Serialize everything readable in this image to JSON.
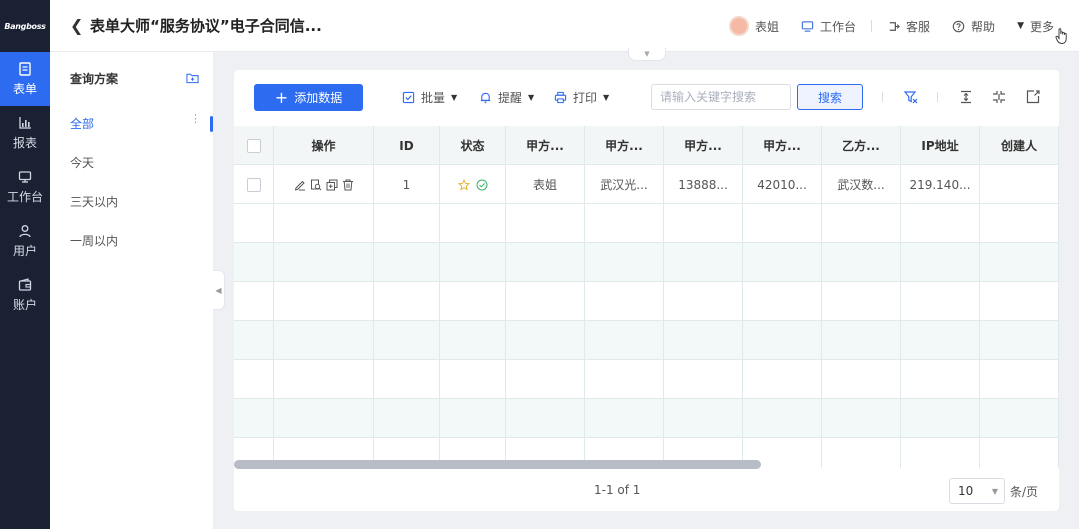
{
  "app": {
    "logo_text": "Bangboss",
    "page_title": "表单大师“服务协议”电子合同信..."
  },
  "rail": [
    {
      "label": "表单",
      "icon": "form-icon",
      "active": true
    },
    {
      "label": "报表",
      "icon": "chart-icon",
      "active": false
    },
    {
      "label": "工作台",
      "icon": "workbench-icon",
      "active": false
    },
    {
      "label": "用户",
      "icon": "user-icon",
      "active": false
    },
    {
      "label": "账户",
      "icon": "wallet-icon",
      "active": false
    }
  ],
  "header": {
    "user_name": "表姐",
    "workbench": "工作台",
    "service": "客服",
    "help": "帮助",
    "more": "更多"
  },
  "plans": {
    "title": "查询方案",
    "items": [
      "全部",
      "今天",
      "三天以内",
      "一周以内"
    ],
    "active_index": 0
  },
  "toolbar": {
    "add_label": "添加数据",
    "batch_label": "批量",
    "remind_label": "提醒",
    "print_label": "打印",
    "search_placeholder": "请输入关键字搜索",
    "search_button": "搜索"
  },
  "table": {
    "columns": [
      "",
      "操作",
      "ID",
      "状态",
      "甲方...",
      "甲方...",
      "甲方...",
      "甲方...",
      "乙方...",
      "IP地址",
      "创建人"
    ],
    "rows": [
      {
        "id": "1",
        "party_a_1": "表姐",
        "party_a_2": "武汉光...",
        "party_a_3": "13888...",
        "party_a_4": "42010...",
        "party_b": "武汉数...",
        "ip": "219.140...",
        "creator": ""
      }
    ]
  },
  "pagination": {
    "info": "1-1 of 1",
    "page_size": "10",
    "per_page_suffix": "条/页"
  },
  "colors": {
    "accent": "#2d6bf0",
    "rail_bg": "#1a2133"
  }
}
